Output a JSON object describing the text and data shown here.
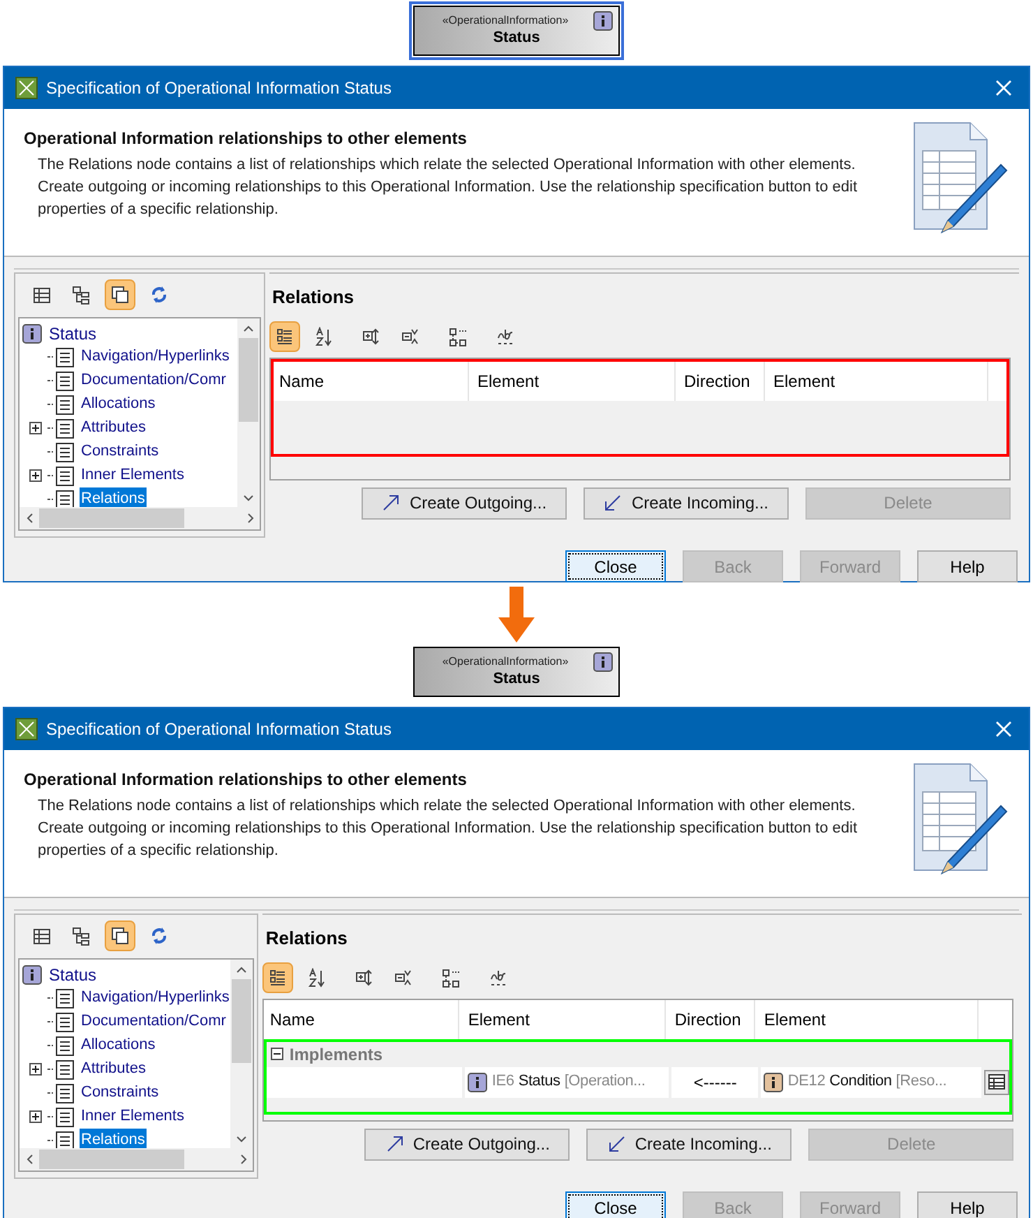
{
  "steps": [
    {
      "node": {
        "stereotype": "«OperationalInformation»",
        "name": "Status",
        "selected": true
      },
      "dialog": {
        "title": "Specification of Operational Information Status",
        "header": {
          "heading": "Operational Information relationships to other elements",
          "description": "The Relations node contains a list of relationships which relate the selected Operational Information with other elements. Create outgoing or incoming relationships to this Operational Information. Use the relationship specification button to edit properties of a specific relationship."
        },
        "tree_toolbar": [
          {
            "selected": false
          },
          {
            "selected": false
          },
          {
            "selected": true
          },
          {
            "selected": false
          }
        ],
        "tree": {
          "label": "Status",
          "children": [
            {
              "label": "Navigation/Hyperlinks",
              "selected": false
            },
            {
              "label": "Documentation/Comr",
              "selected": false
            },
            {
              "label": "Allocations",
              "selected": false
            },
            {
              "label": "Attributes",
              "expanded": false,
              "selected": false
            },
            {
              "label": "Constraints",
              "selected": false
            },
            {
              "label": "Inner Elements",
              "expanded": false,
              "selected": false
            },
            {
              "label": "Relations",
              "selected": true
            }
          ]
        },
        "panel_title": "Relations",
        "table_toolbar": [
          {
            "selected": true
          },
          {
            "selected": false
          },
          {
            "selected": false
          },
          {
            "selected": false
          },
          {
            "selected": false
          },
          {
            "selected": false
          }
        ],
        "table": {
          "columns": [
            "Name",
            "Element",
            "Direction",
            "Element"
          ],
          "highlight": {
            "color": "#ff0000"
          }
        },
        "actions": [
          {
            "label": "Create Outgoing...",
            "kind": "outgoing",
            "disabled": false
          },
          {
            "label": "Create Incoming...",
            "kind": "incoming",
            "disabled": false
          },
          {
            "label": "Delete",
            "kind": "plain",
            "disabled": true
          }
        ],
        "buttons": [
          {
            "label": "Close",
            "focused": true,
            "disabled": false
          },
          {
            "label": "Back",
            "focused": false,
            "disabled": true
          },
          {
            "label": "Forward",
            "focused": false,
            "disabled": true
          },
          {
            "label": "Help",
            "focused": false,
            "disabled": false
          }
        ]
      }
    },
    {
      "node": {
        "stereotype": "«OperationalInformation»",
        "name": "Status",
        "selected": false
      },
      "dialog": {
        "title": "Specification of Operational Information Status",
        "header": {
          "heading": "Operational Information relationships to other elements",
          "description": "The Relations node contains a list of relationships which relate the selected Operational Information with other elements. Create outgoing or incoming relationships to this Operational Information. Use the relationship specification button to edit properties of a specific relationship."
        },
        "tree_toolbar": [
          {
            "selected": false
          },
          {
            "selected": false
          },
          {
            "selected": true
          },
          {
            "selected": false
          }
        ],
        "tree": {
          "label": "Status",
          "children": [
            {
              "label": "Navigation/Hyperlinks",
              "selected": false
            },
            {
              "label": "Documentation/Comr",
              "selected": false
            },
            {
              "label": "Allocations",
              "selected": false
            },
            {
              "label": "Attributes",
              "expanded": false,
              "selected": false
            },
            {
              "label": "Constraints",
              "selected": false
            },
            {
              "label": "Inner Elements",
              "expanded": false,
              "selected": false
            },
            {
              "label": "Relations",
              "selected": true
            }
          ]
        },
        "panel_title": "Relations",
        "table_toolbar": [
          {
            "selected": true
          },
          {
            "selected": false
          },
          {
            "selected": false
          },
          {
            "selected": false
          },
          {
            "selected": false
          },
          {
            "selected": false
          }
        ],
        "table": {
          "columns": [
            "Name",
            "Element",
            "Direction",
            "Element"
          ],
          "highlight": {
            "color": "#00ff00"
          },
          "groups": [
            {
              "label": "Implements",
              "expanded": true,
              "rows": [
                {
                  "source": {
                    "id": "IE6",
                    "name": "Status",
                    "type": "[Operation...",
                    "color": "#a6a6d8"
                  },
                  "direction": "<------",
                  "target": {
                    "id": "DE12",
                    "name": "Condition",
                    "type": "[Reso...",
                    "color": "#e3c19d"
                  }
                }
              ]
            }
          ]
        },
        "actions": [
          {
            "label": "Create Outgoing...",
            "kind": "outgoing",
            "disabled": false
          },
          {
            "label": "Create Incoming...",
            "kind": "incoming",
            "disabled": false
          },
          {
            "label": "Delete",
            "kind": "plain",
            "disabled": true
          }
        ],
        "buttons": [
          {
            "label": "Close",
            "focused": true,
            "disabled": false
          },
          {
            "label": "Back",
            "focused": false,
            "disabled": true
          },
          {
            "label": "Forward",
            "focused": false,
            "disabled": true
          },
          {
            "label": "Help",
            "focused": false,
            "disabled": false
          }
        ]
      }
    }
  ]
}
